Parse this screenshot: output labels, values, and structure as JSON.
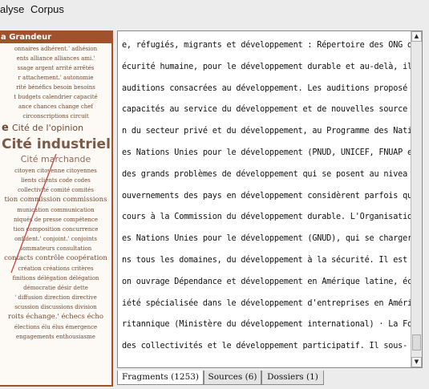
{
  "menubar": {
    "items": [
      "alyse",
      "Corpus"
    ]
  },
  "left_panel": {
    "title": "a Grandeur",
    "rows": [
      "onnaires  adhérent.'  adhésion",
      "ents  alliance  alliances  ami.'",
      "ssage  argent  arrité  arrêtés",
      "r  attachement.'  autonomie",
      "rité  bénéfics  besoin  besoins",
      "t  budgets  calendrier  capacité",
      "ance  chances  change  chef",
      "circonscriptions  circuit"
    ],
    "opinion_row": {
      "prefix": "e",
      "text": "Cité de l'opinion"
    },
    "industrielle": "Cité industrielle",
    "marchande": "Cité marchande",
    "rows2": [
      "  citoyen  citoyenne  citoyennes",
      "lients  clients  code  codes",
      "  collectivité  comité  comités",
      "tion  commission  commissions",
      "munication  communication",
      "niqués de presse  compétence",
      "tion  composition  concurrence",
      "onfident.'  conjoint.'  conjoints",
      "sommateurs  consultation",
      "contacts  contrôle  coopération",
      "  création  créations  critères",
      "finitions  délégation  délégation",
      "  démocratie  désir  dette",
      "'  diffusion  direction  directive",
      "scussion  discussions  division",
      "roits  échange.'  échecs  écho",
      "  élections  élu  élus  émergence",
      "  engagements  enthousiasme"
    ]
  },
  "text_lines": [
    "e, réfugiés, migrants et développement : Répertoire des ONG d",
    "écurité humaine, pour le développement durable et au-delà, il",
    " auditions consacrées au développement. Les auditions proposé",
    " capacités au service du développement et de nouvelles source",
    "n du secteur privé et du développement, au Programme des Nati",
    "es Nations Unies pour le développement (PNUD, UNICEF, FNUAP e",
    " des grands problèmes de développement qui se posent au nivea",
    "ouvernements des pays en développement considèrent parfois qu",
    "cours à la Commission du développement durable. L'Organisatio",
    "es Nations Unies pour le développement (GNUD), qui se charger",
    "ns tous les domaines, du développement à la sécurité. Il est ",
    "on ouvrage Dépendance et développement en Amérique latine, éc",
    "iété spécialisée dans le développement d'entreprises en Améri",
    "ritannique (Ministère du développement international) · La Fo",
    " des collectivités et le développement participatif. Il sous-"
  ],
  "tabs": [
    {
      "label": "Fragments (1253)"
    },
    {
      "label": "Sources (6)"
    },
    {
      "label": "Dossiers (1)"
    }
  ],
  "colors": {
    "accent": "#a0522d",
    "cloud_text": "#6d4a35",
    "arrow": "#cc4444"
  }
}
